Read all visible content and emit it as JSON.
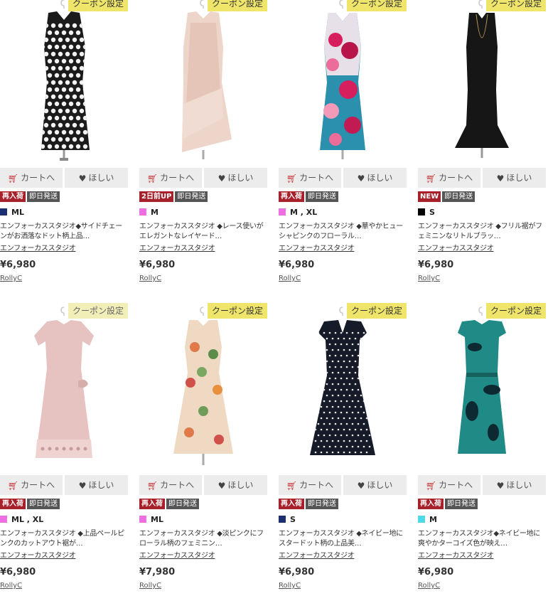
{
  "products": [
    {
      "coupon": "クーポン設定",
      "coupon_style": "bright",
      "cart_label": "カートへ",
      "want_label": "ほしい",
      "badges": [
        {
          "text": "再入荷",
          "style": "red"
        },
        {
          "text": "即日発送",
          "style": "dark"
        }
      ],
      "swatch_color": "#1c2f6e",
      "sizes": "ML",
      "desc": "エンフォーカススタジオ◆サイドチェーンがお洒落なドット柄上品…",
      "brand": "エンフォーカススタジオ",
      "price": "¥6,980",
      "shop": "RollyC",
      "dress": "black-white-dots"
    },
    {
      "coupon": "クーポン設定",
      "coupon_style": "bright",
      "cart_label": "カートへ",
      "want_label": "ほしい",
      "badges": [
        {
          "text": "2日前UP",
          "style": "red"
        },
        {
          "text": "即日発送",
          "style": "dark"
        }
      ],
      "swatch_color": "#ee6fe0",
      "sizes": "M",
      "desc": "エンフォーカススタジオ ◆レース使いがエレガントなレイヤード…",
      "brand": "エンフォーカススタジオ",
      "price": "¥6,980",
      "shop": "RollyC",
      "dress": "pink-lace"
    },
    {
      "coupon": "クーポン設定",
      "coupon_style": "bright",
      "cart_label": "カートへ",
      "want_label": "ほしい",
      "badges": [
        {
          "text": "再入荷",
          "style": "red"
        },
        {
          "text": "即日発送",
          "style": "dark"
        }
      ],
      "swatch_color": "#ee6fe0",
      "sizes": "M , XL",
      "desc": "エンフォーカススタジオ ◆華やかヒューシャピンクのフローラル…",
      "brand": "エンフォーカススタジオ",
      "price": "¥6,980",
      "shop": "RollyC",
      "dress": "floral-pink-blue"
    },
    {
      "coupon": "クーポン設定",
      "coupon_style": "bright",
      "cart_label": "カートへ",
      "want_label": "ほしい",
      "badges": [
        {
          "text": "NEW",
          "style": "red"
        },
        {
          "text": "即日発送",
          "style": "dark"
        }
      ],
      "swatch_color": "#000000",
      "sizes": "S",
      "desc": "エンフォーカススタジオ ◆フリル裾がフェミニンなリトルブラッ…",
      "brand": "エンフォーカススタジオ",
      "price": "¥6,980",
      "shop": "RollyC",
      "dress": "black-mermaid"
    },
    {
      "coupon": "クーポン設定",
      "coupon_style": "pale",
      "cart_label": "カートへ",
      "want_label": "ほしい",
      "badges": [
        {
          "text": "再入荷",
          "style": "red"
        },
        {
          "text": "即日発送",
          "style": "dark"
        }
      ],
      "swatch_color": "#ee6fe0",
      "sizes": "ML , XL",
      "desc": "エンフォーカススタジオ ◆上品ペールピンクのカットアウト裾が…",
      "brand": "エンフォーカススタジオ",
      "price": "¥6,980",
      "shop": "RollyC",
      "dress": "pale-pink-sleeve"
    },
    {
      "coupon": "クーポン設定",
      "coupon_style": "bright",
      "cart_label": "カートへ",
      "want_label": "ほしい",
      "badges": [
        {
          "text": "再入荷",
          "style": "red"
        },
        {
          "text": "即日発送",
          "style": "dark"
        }
      ],
      "swatch_color": "#ee6fe0",
      "sizes": "ML",
      "desc": "エンフォーカススタジオ ◆淡ピンクにフローラル柄のフェミニン…",
      "brand": "エンフォーカススタジオ",
      "price": "¥7,980",
      "shop": "RollyC",
      "dress": "beige-floral"
    },
    {
      "coupon": "クーポン設定",
      "coupon_style": "bright",
      "cart_label": "カートへ",
      "want_label": "ほしい",
      "badges": [
        {
          "text": "再入荷",
          "style": "red"
        },
        {
          "text": "即日発送",
          "style": "dark"
        }
      ],
      "swatch_color": "#1c2f6e",
      "sizes": "S",
      "desc": "エンフォーカススタジオ ◆ネイビー地にスタードット柄の上品美…",
      "brand": "エンフォーカススタジオ",
      "price": "¥6,980",
      "shop": "RollyC",
      "dress": "navy-dots"
    },
    {
      "coupon": "クーポン設定",
      "coupon_style": "bright",
      "cart_label": "カートへ",
      "want_label": "ほしい",
      "badges": [
        {
          "text": "再入荷",
          "style": "red"
        },
        {
          "text": "即日発送",
          "style": "dark"
        }
      ],
      "swatch_color": "#4fd9e8",
      "sizes": "M",
      "desc": "エンフォーカススタジオ◆ネイビー地に爽やかターコイズ色が映え…",
      "brand": "エンフォーカススタジオ",
      "price": "¥6,980",
      "shop": "RollyC",
      "dress": "teal-paisley"
    }
  ]
}
